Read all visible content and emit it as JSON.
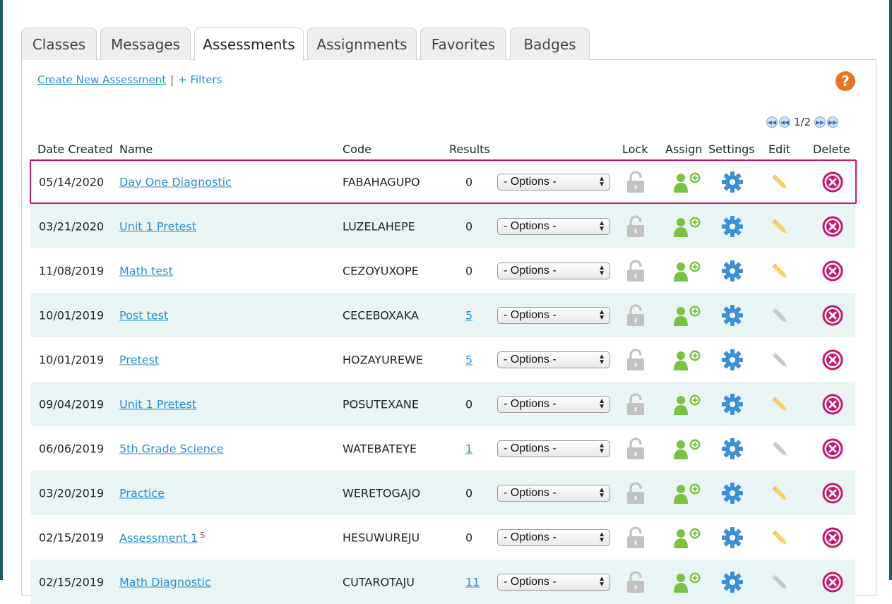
{
  "tabs": [
    {
      "label": "Classes",
      "active": false
    },
    {
      "label": "Messages",
      "active": false
    },
    {
      "label": "Assessments",
      "active": true
    },
    {
      "label": "Assignments",
      "active": false
    },
    {
      "label": "Favorites",
      "active": false
    },
    {
      "label": "Badges",
      "active": false
    }
  ],
  "toolbar": {
    "create_label": "Create New Assessment",
    "separator": "|",
    "filters_label": "+ Filters",
    "help_label": "?"
  },
  "pager": {
    "current": "1/2"
  },
  "columns": {
    "date": "Date Created",
    "name": "Name",
    "code": "Code",
    "results": "Results",
    "lock": "Lock",
    "assign": "Assign",
    "settings": "Settings",
    "edit": "Edit",
    "delete": "Delete"
  },
  "options_label": "- Options -",
  "colors": {
    "link": "#2a8fd0",
    "selected_border": "#c8176c",
    "row_alt": "#e9f5f5",
    "assign_green": "#7cc242",
    "settings_blue": "#3d8fd6",
    "edit_yellow": "#f5d35c",
    "edit_gray": "#c8c8c8",
    "delete_magenta": "#c8176c",
    "help_orange": "#f07021"
  },
  "rows": [
    {
      "date": "05/14/2020",
      "name": "Day One Diagnostic",
      "code": "FABAHAGUPO",
      "results": "0",
      "results_link": false,
      "edit_enabled": true,
      "selected": true
    },
    {
      "date": "03/21/2020",
      "name": "Unit 1 Pretest",
      "code": "LUZELAHEPE",
      "results": "0",
      "results_link": false,
      "edit_enabled": true
    },
    {
      "date": "11/08/2019",
      "name": "Math test",
      "code": "CEZOYUXOPE",
      "results": "0",
      "results_link": false,
      "edit_enabled": true
    },
    {
      "date": "10/01/2019",
      "name": "Post test",
      "code": "CECEBOXAKA",
      "results": "5",
      "results_link": true,
      "edit_enabled": false
    },
    {
      "date": "10/01/2019",
      "name": "Pretest",
      "code": "HOZAYUREWE",
      "results": "5",
      "results_link": true,
      "edit_enabled": false
    },
    {
      "date": "09/04/2019",
      "name": "Unit 1 Pretest",
      "code": "POSUTEXANE",
      "results": "0",
      "results_link": false,
      "edit_enabled": true
    },
    {
      "date": "06/06/2019",
      "name": "5th Grade Science",
      "code": "WATEBATEYE",
      "results": "1",
      "results_link": true,
      "edit_enabled": false
    },
    {
      "date": "03/20/2019",
      "name": "Practice",
      "code": "WERETOGAJO",
      "results": "0",
      "results_link": false,
      "edit_enabled": true
    },
    {
      "date": "02/15/2019",
      "name": "Assessment 1",
      "name_sup": "S",
      "code": "HESUWUREJU",
      "results": "0",
      "results_link": false,
      "edit_enabled": true
    },
    {
      "date": "02/15/2019",
      "name": "Math Diagnostic",
      "code": "CUTAROTAJU",
      "results": "11",
      "results_link": true,
      "edit_enabled": false
    }
  ]
}
